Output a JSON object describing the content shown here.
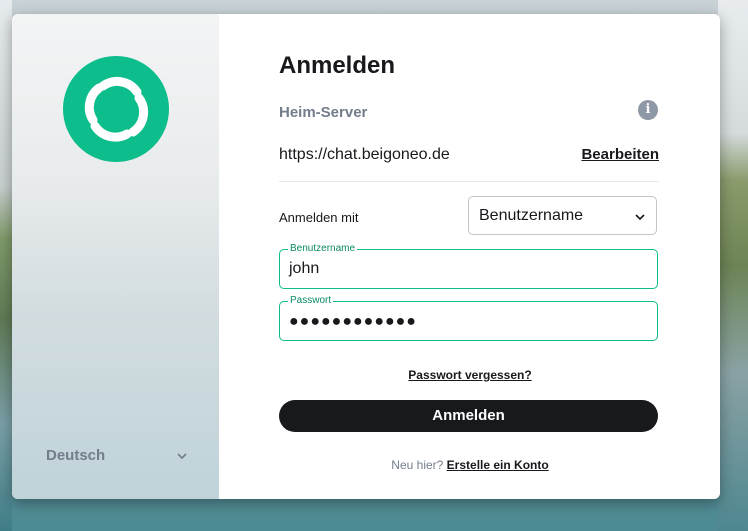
{
  "sidebar": {
    "language": "Deutsch"
  },
  "login": {
    "title": "Anmelden",
    "homeserver_label": "Heim-Server",
    "homeserver_url": "https://chat.beigoneo.de",
    "edit_label": "Bearbeiten",
    "signin_with_label": "Anmelden mit",
    "signin_with_value": "Benutzername",
    "username_label": "Benutzername",
    "username_value": "john",
    "password_label": "Passwort",
    "password_mask": "●●●●●●●●●●●●",
    "forgot_label": "Passwort vergessen?",
    "submit_label": "Anmelden",
    "new_here_text": "Neu hier?",
    "create_account_label": "Erstelle ein Konto"
  },
  "icons": {
    "logo": "element-logo-icon",
    "info": "info-icon",
    "chevron": "chevron-down-icon"
  },
  "colors": {
    "accent": "#0dbd8b",
    "primary_button": "#17191c",
    "muted_text": "#737d8c"
  }
}
